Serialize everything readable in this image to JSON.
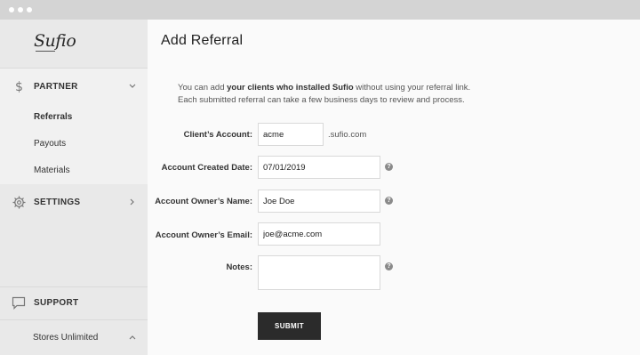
{
  "app": {
    "logo": "Sufio"
  },
  "sidebar": {
    "partner": {
      "label": "PARTNER"
    },
    "subitems": [
      {
        "label": "Referrals"
      },
      {
        "label": "Payouts"
      },
      {
        "label": "Materials"
      }
    ],
    "settings": {
      "label": "SETTINGS"
    },
    "support": {
      "label": "SUPPORT"
    },
    "store": {
      "label": "Stores Unlimited"
    }
  },
  "page": {
    "title": "Add Referral",
    "intro_prefix": "You can add ",
    "intro_bold": "your clients who installed Sufio",
    "intro_suffix": " without using your referral link.",
    "intro_line2": "Each submitted referral can take a few business days to review and process."
  },
  "form": {
    "client_account": {
      "label": "Client’s Account:",
      "value": "acme",
      "suffix": ".sufio.com"
    },
    "created_date": {
      "label": "Account Created Date:",
      "value": "07/01/2019"
    },
    "owner_name": {
      "label": "Account Owner’s Name:",
      "value": "Joe Doe"
    },
    "owner_email": {
      "label": "Account Owner’s Email:",
      "value": "joe@acme.com"
    },
    "notes": {
      "label": "Notes:",
      "value": ""
    },
    "help_glyph": "?",
    "submit_label": "SUBMIT"
  },
  "icons": {
    "partner": "dollar-icon",
    "settings": "gear-icon",
    "support": "chat-bubble-icon",
    "help": "question-circle-icon"
  }
}
